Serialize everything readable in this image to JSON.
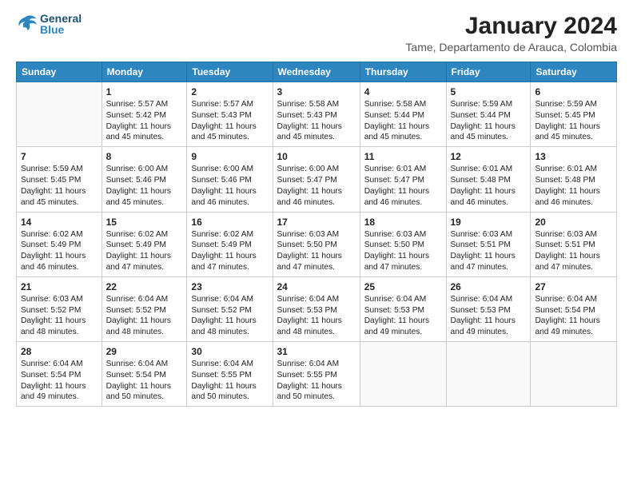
{
  "header": {
    "logo_general": "General",
    "logo_blue": "Blue",
    "title": "January 2024",
    "subtitle": "Tame, Departamento de Arauca, Colombia"
  },
  "days_of_week": [
    "Sunday",
    "Monday",
    "Tuesday",
    "Wednesday",
    "Thursday",
    "Friday",
    "Saturday"
  ],
  "weeks": [
    [
      {
        "day": "",
        "info": ""
      },
      {
        "day": "1",
        "info": "Sunrise: 5:57 AM\nSunset: 5:42 PM\nDaylight: 11 hours\nand 45 minutes."
      },
      {
        "day": "2",
        "info": "Sunrise: 5:57 AM\nSunset: 5:43 PM\nDaylight: 11 hours\nand 45 minutes."
      },
      {
        "day": "3",
        "info": "Sunrise: 5:58 AM\nSunset: 5:43 PM\nDaylight: 11 hours\nand 45 minutes."
      },
      {
        "day": "4",
        "info": "Sunrise: 5:58 AM\nSunset: 5:44 PM\nDaylight: 11 hours\nand 45 minutes."
      },
      {
        "day": "5",
        "info": "Sunrise: 5:59 AM\nSunset: 5:44 PM\nDaylight: 11 hours\nand 45 minutes."
      },
      {
        "day": "6",
        "info": "Sunrise: 5:59 AM\nSunset: 5:45 PM\nDaylight: 11 hours\nand 45 minutes."
      }
    ],
    [
      {
        "day": "7",
        "info": "Sunrise: 5:59 AM\nSunset: 5:45 PM\nDaylight: 11 hours\nand 45 minutes."
      },
      {
        "day": "8",
        "info": "Sunrise: 6:00 AM\nSunset: 5:46 PM\nDaylight: 11 hours\nand 45 minutes."
      },
      {
        "day": "9",
        "info": "Sunrise: 6:00 AM\nSunset: 5:46 PM\nDaylight: 11 hours\nand 46 minutes."
      },
      {
        "day": "10",
        "info": "Sunrise: 6:00 AM\nSunset: 5:47 PM\nDaylight: 11 hours\nand 46 minutes."
      },
      {
        "day": "11",
        "info": "Sunrise: 6:01 AM\nSunset: 5:47 PM\nDaylight: 11 hours\nand 46 minutes."
      },
      {
        "day": "12",
        "info": "Sunrise: 6:01 AM\nSunset: 5:48 PM\nDaylight: 11 hours\nand 46 minutes."
      },
      {
        "day": "13",
        "info": "Sunrise: 6:01 AM\nSunset: 5:48 PM\nDaylight: 11 hours\nand 46 minutes."
      }
    ],
    [
      {
        "day": "14",
        "info": "Sunrise: 6:02 AM\nSunset: 5:49 PM\nDaylight: 11 hours\nand 46 minutes."
      },
      {
        "day": "15",
        "info": "Sunrise: 6:02 AM\nSunset: 5:49 PM\nDaylight: 11 hours\nand 47 minutes."
      },
      {
        "day": "16",
        "info": "Sunrise: 6:02 AM\nSunset: 5:49 PM\nDaylight: 11 hours\nand 47 minutes."
      },
      {
        "day": "17",
        "info": "Sunrise: 6:03 AM\nSunset: 5:50 PM\nDaylight: 11 hours\nand 47 minutes."
      },
      {
        "day": "18",
        "info": "Sunrise: 6:03 AM\nSunset: 5:50 PM\nDaylight: 11 hours\nand 47 minutes."
      },
      {
        "day": "19",
        "info": "Sunrise: 6:03 AM\nSunset: 5:51 PM\nDaylight: 11 hours\nand 47 minutes."
      },
      {
        "day": "20",
        "info": "Sunrise: 6:03 AM\nSunset: 5:51 PM\nDaylight: 11 hours\nand 47 minutes."
      }
    ],
    [
      {
        "day": "21",
        "info": "Sunrise: 6:03 AM\nSunset: 5:52 PM\nDaylight: 11 hours\nand 48 minutes."
      },
      {
        "day": "22",
        "info": "Sunrise: 6:04 AM\nSunset: 5:52 PM\nDaylight: 11 hours\nand 48 minutes."
      },
      {
        "day": "23",
        "info": "Sunrise: 6:04 AM\nSunset: 5:52 PM\nDaylight: 11 hours\nand 48 minutes."
      },
      {
        "day": "24",
        "info": "Sunrise: 6:04 AM\nSunset: 5:53 PM\nDaylight: 11 hours\nand 48 minutes."
      },
      {
        "day": "25",
        "info": "Sunrise: 6:04 AM\nSunset: 5:53 PM\nDaylight: 11 hours\nand 49 minutes."
      },
      {
        "day": "26",
        "info": "Sunrise: 6:04 AM\nSunset: 5:53 PM\nDaylight: 11 hours\nand 49 minutes."
      },
      {
        "day": "27",
        "info": "Sunrise: 6:04 AM\nSunset: 5:54 PM\nDaylight: 11 hours\nand 49 minutes."
      }
    ],
    [
      {
        "day": "28",
        "info": "Sunrise: 6:04 AM\nSunset: 5:54 PM\nDaylight: 11 hours\nand 49 minutes."
      },
      {
        "day": "29",
        "info": "Sunrise: 6:04 AM\nSunset: 5:54 PM\nDaylight: 11 hours\nand 50 minutes."
      },
      {
        "day": "30",
        "info": "Sunrise: 6:04 AM\nSunset: 5:55 PM\nDaylight: 11 hours\nand 50 minutes."
      },
      {
        "day": "31",
        "info": "Sunrise: 6:04 AM\nSunset: 5:55 PM\nDaylight: 11 hours\nand 50 minutes."
      },
      {
        "day": "",
        "info": ""
      },
      {
        "day": "",
        "info": ""
      },
      {
        "day": "",
        "info": ""
      }
    ]
  ]
}
